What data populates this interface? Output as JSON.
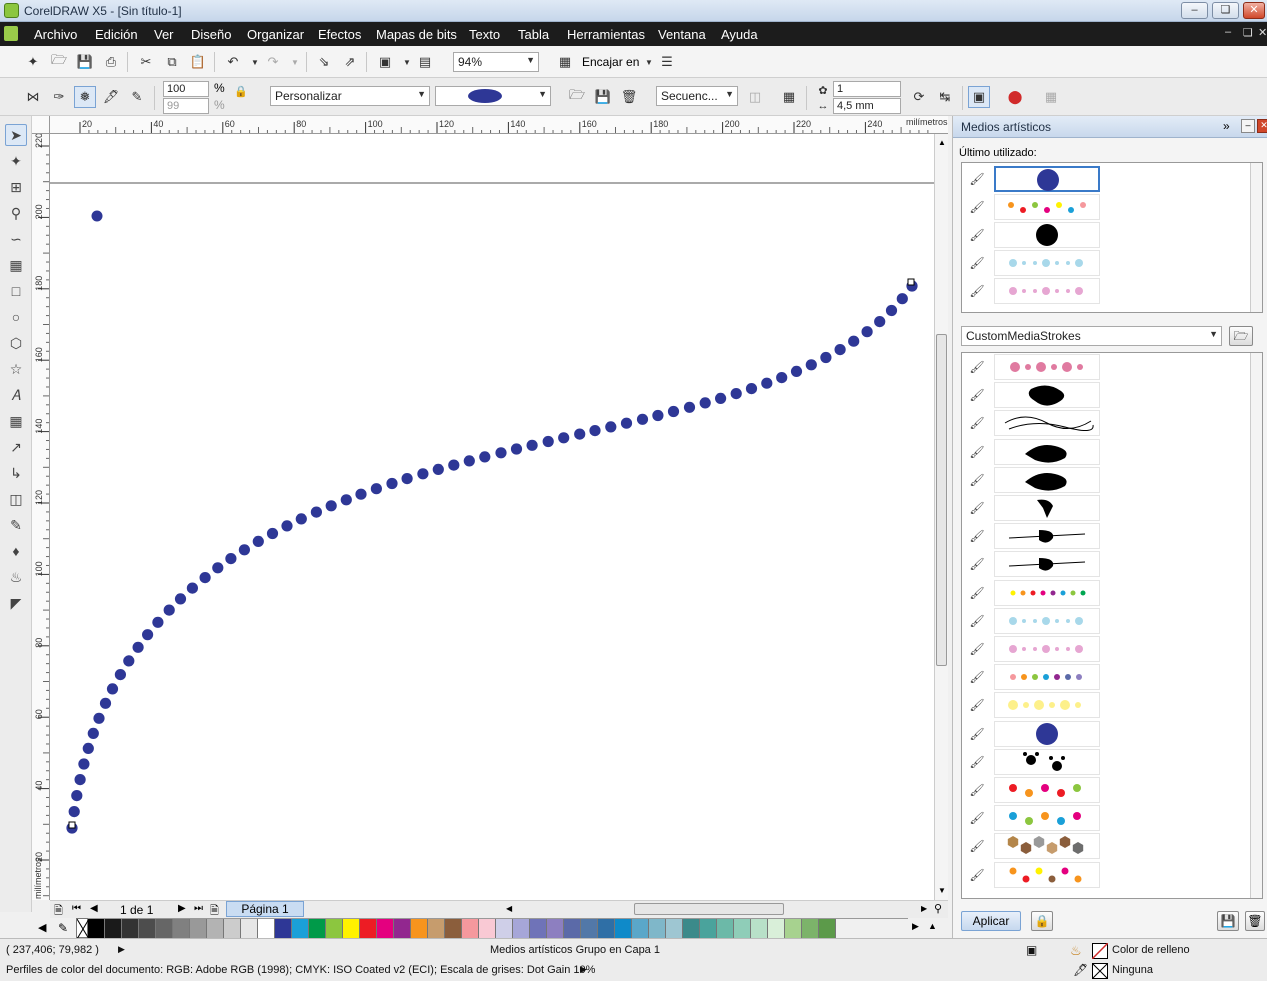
{
  "window": {
    "title": "CorelDRAW X5 - [Sin título-1]"
  },
  "menu": [
    "Archivo",
    "Edición",
    "Ver",
    "Diseño",
    "Organizar",
    "Efectos",
    "Mapas de bits",
    "Texto",
    "Tabla",
    "Herramientas",
    "Ventana",
    "Ayuda"
  ],
  "toolbar1": {
    "zoom": "94%",
    "snap_label": "Encajar en"
  },
  "toolbar2": {
    "scale_x": "100",
    "scale_y": "99",
    "pct_sign": "%",
    "preset": "Personalizar",
    "sequence": "Secuenc...",
    "spacing_count": "1",
    "spacing_size": "4,5 mm"
  },
  "rulers": {
    "h_ticks": [
      "20",
      "40",
      "60",
      "80",
      "100",
      "120",
      "140",
      "160",
      "180",
      "200",
      "220",
      "240"
    ],
    "h_unit": "milímetros",
    "v_ticks": [
      "220",
      "200",
      "180",
      "160",
      "140",
      "120",
      "100",
      "80",
      "60",
      "40",
      "20"
    ],
    "v_unit": "milímetros"
  },
  "page_nav": {
    "count": "1 de 1",
    "tab": "Página 1"
  },
  "docker": {
    "title": "Medios artísticos",
    "last_used_label": "Último utilizado:",
    "library": "CustomMediaStrokes",
    "apply": "Aplicar"
  },
  "status": {
    "coords": "( 237,406; 79,982 )",
    "selection": "Medios artísticos Grupo en Capa 1",
    "profiles": "Perfiles de color del documento: RGB: Adobe RGB (1998); CMYK: ISO Coated v2 (ECI); Escala de grises: Dot Gain 10%",
    "fill_label": "Color de relleno",
    "outline_label": "Ninguna"
  },
  "colors": {
    "dot": "#2e3796",
    "palette": [
      "#000000",
      "#1a1a1a",
      "#333333",
      "#4d4d4d",
      "#666666",
      "#808080",
      "#999999",
      "#b3b3b3",
      "#cccccc",
      "#e6e6e6",
      "#ffffff",
      "#2e3796",
      "#1aa0d8",
      "#009a49",
      "#8cc63f",
      "#fff200",
      "#ed1c24",
      "#e4007f",
      "#92278f",
      "#f7941d",
      "#c69c6d",
      "#8b5e3c",
      "#f5989d",
      "#f9c9d4",
      "#cfcfe8",
      "#a6a6d8",
      "#6f73b8",
      "#8d7fc0",
      "#5b6aa8",
      "#5278a8",
      "#2f6fa6",
      "#0f8ac9",
      "#5aa7c9",
      "#7fb7c9",
      "#9ec6d2",
      "#3b8a8a",
      "#4aa39c",
      "#6cb9a8",
      "#8fcdb8",
      "#b8e0c8",
      "#d9efd9",
      "#a7d28f",
      "#7cb36a",
      "#5c9a4a"
    ]
  }
}
